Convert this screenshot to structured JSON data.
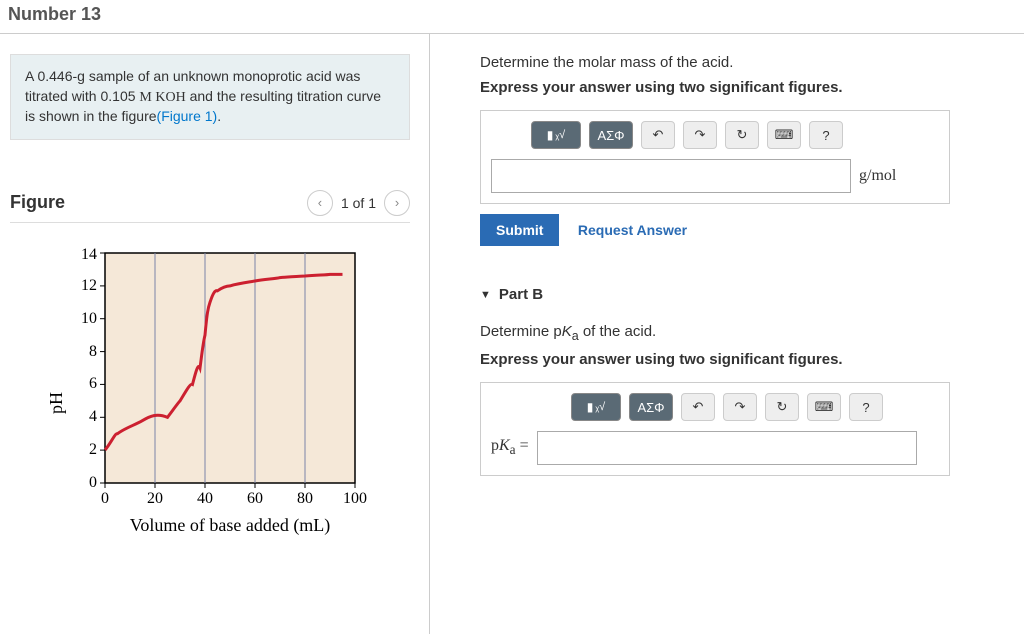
{
  "page_title": "Number 13",
  "problem": {
    "text_a": "A 0.446-g sample of an unknown monoprotic acid was titrated with 0.105 ",
    "koh": "M KOH",
    "text_b": " and the resulting titration curve is shown in the figure",
    "figlink": "(Figure 1)",
    "text_c": "."
  },
  "figure": {
    "title": "Figure",
    "pager": "1 of 1",
    "xlabel": "Volume of base added (mL)",
    "ylabel": "pH"
  },
  "partA": {
    "instr": "Determine the molar mass of the acid.",
    "sub": "Express your answer using two significant figures.",
    "unit": "g/mol",
    "submit": "Submit",
    "request": "Request Answer"
  },
  "partB": {
    "header": "Part B",
    "instr": "Determine pKₐ of the acid.",
    "sub": "Express your answer using two significant figures.",
    "label": "pKₐ ="
  },
  "toolbar": {
    "square": "■",
    "root": "√",
    "greek": "ΑΣΦ",
    "undo": "↶",
    "redo": "↷",
    "reset": "↻",
    "keyboard": "⌨",
    "help": "?"
  },
  "chart_data": {
    "type": "line",
    "title": "",
    "xlabel": "Volume of base added (mL)",
    "ylabel": "pH",
    "xlim": [
      0,
      100
    ],
    "ylim": [
      0,
      14
    ],
    "x_ticks": [
      0,
      20,
      40,
      60,
      80,
      100
    ],
    "y_ticks": [
      0,
      2,
      4,
      6,
      8,
      10,
      12,
      14
    ],
    "series": [
      {
        "name": "titration-curve",
        "x": [
          0,
          5,
          10,
          15,
          20,
          25,
          30,
          35,
          38,
          40,
          42,
          45,
          50,
          60,
          70,
          80,
          90,
          95
        ],
        "y": [
          2.0,
          3.0,
          3.5,
          3.8,
          4.0,
          4.5,
          5.0,
          6.0,
          7.0,
          9.0,
          11.0,
          11.7,
          12.0,
          12.3,
          12.5,
          12.6,
          12.7,
          12.7
        ]
      }
    ]
  }
}
